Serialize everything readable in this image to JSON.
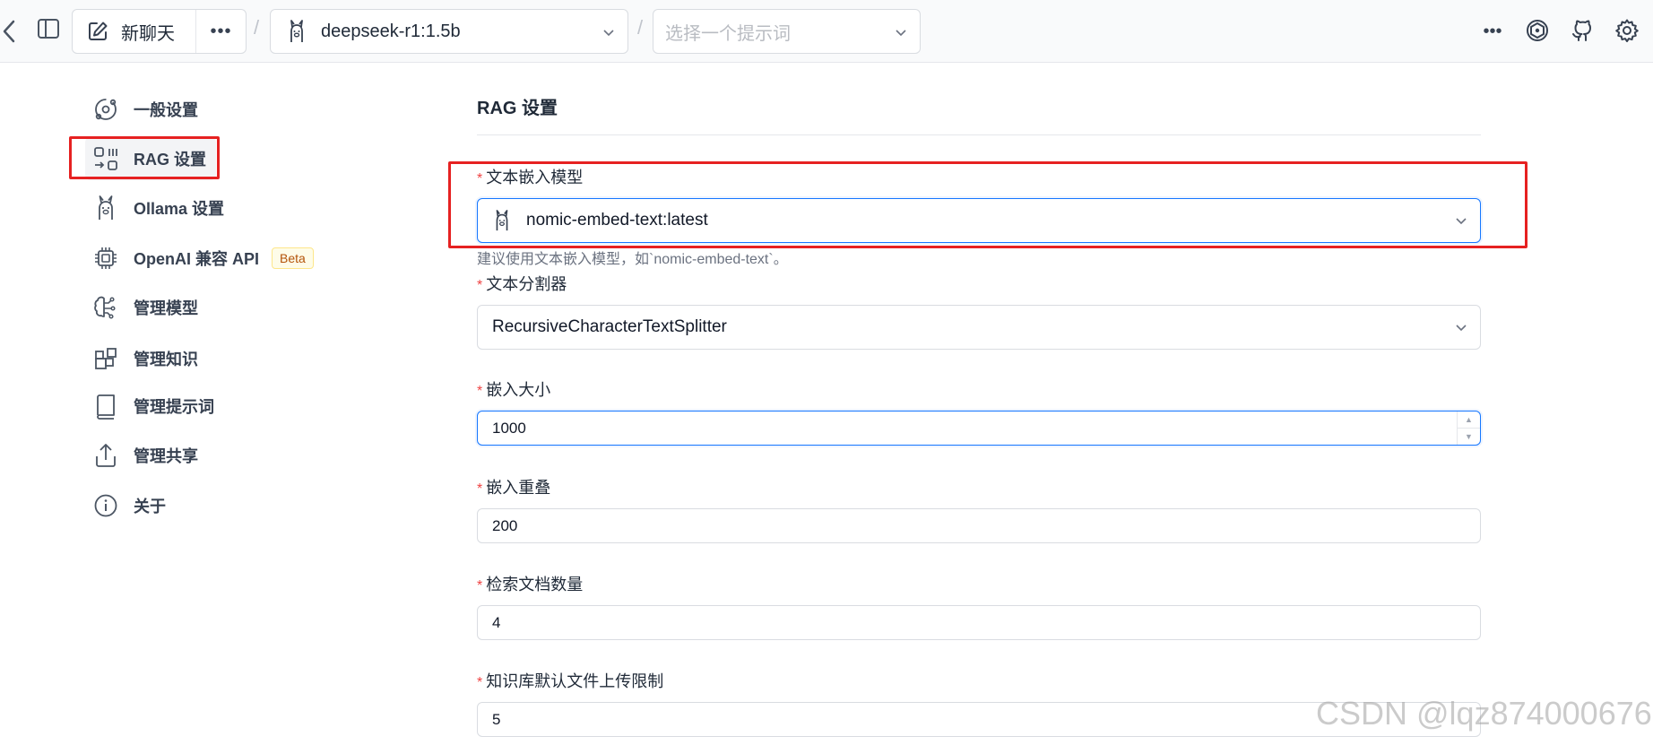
{
  "topbar": {
    "chat_label": "新聊天",
    "model_label": "deepseek-r1:1.5b",
    "prompt_placeholder": "选择一个提示词",
    "separator": "/"
  },
  "sidebar": {
    "items": [
      {
        "label": "一般设置",
        "icon": "orbit-icon"
      },
      {
        "label": "RAG 设置",
        "icon": "rag-icon",
        "active": true
      },
      {
        "label": "Ollama 设置",
        "icon": "llama-icon"
      },
      {
        "label": "OpenAI 兼容 API",
        "icon": "chip-icon",
        "badge": "Beta"
      },
      {
        "label": "管理模型",
        "icon": "brain-icon"
      },
      {
        "label": "管理知识",
        "icon": "blocks-icon"
      },
      {
        "label": "管理提示词",
        "icon": "book-icon"
      },
      {
        "label": "管理共享",
        "icon": "share-icon"
      },
      {
        "label": "关于",
        "icon": "info-icon"
      }
    ]
  },
  "form": {
    "title": "RAG 设置",
    "embed_model": {
      "label": "文本嵌入模型",
      "value": "nomic-embed-text:latest",
      "help": "建议使用文本嵌入模型，如`nomic-embed-text`。"
    },
    "splitter": {
      "label": "文本分割器",
      "value": "RecursiveCharacterTextSplitter"
    },
    "chunk_size": {
      "label": "嵌入大小",
      "value": "1000"
    },
    "chunk_overlap": {
      "label": "嵌入重叠",
      "value": "200"
    },
    "retrieve_count": {
      "label": "检索文档数量",
      "value": "4"
    },
    "upload_limit": {
      "label": "知识库默认文件上传限制",
      "value": "5"
    },
    "required_mark": "*"
  },
  "watermark": "CSDN @lqz874000676",
  "colors": {
    "accent": "#1677ff",
    "highlight": "#e62121",
    "required": "#ef4444"
  }
}
